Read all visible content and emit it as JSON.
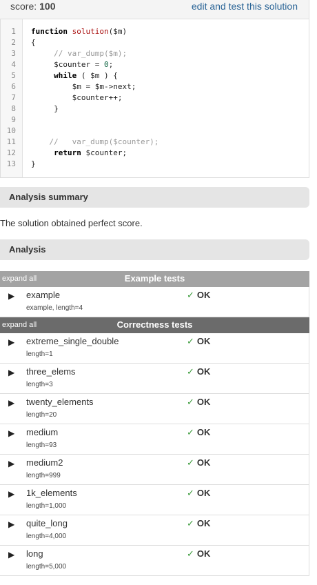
{
  "header": {
    "score_label": "score:",
    "score_value": "100",
    "edit_link": "edit and test this solution"
  },
  "code": {
    "lines": [
      {
        "n": "1",
        "parts": [
          {
            "t": "function",
            "c": "kw"
          },
          {
            "t": " ",
            "c": ""
          },
          {
            "t": "solution",
            "c": "fn"
          },
          {
            "t": "($m)",
            "c": ""
          }
        ]
      },
      {
        "n": "2",
        "parts": [
          {
            "t": "{",
            "c": ""
          }
        ]
      },
      {
        "n": "3",
        "parts": [
          {
            "t": "     // var_dump($m);",
            "c": "cm"
          }
        ]
      },
      {
        "n": "4",
        "parts": [
          {
            "t": "     $counter = ",
            "c": ""
          },
          {
            "t": "0",
            "c": "num"
          },
          {
            "t": ";",
            "c": ""
          }
        ]
      },
      {
        "n": "5",
        "parts": [
          {
            "t": "     ",
            "c": ""
          },
          {
            "t": "while",
            "c": "kw"
          },
          {
            "t": " ( $m ) {",
            "c": ""
          }
        ]
      },
      {
        "n": "6",
        "parts": [
          {
            "t": "         $m = $m->next;",
            "c": ""
          }
        ]
      },
      {
        "n": "7",
        "parts": [
          {
            "t": "         $counter++;",
            "c": ""
          }
        ]
      },
      {
        "n": "8",
        "parts": [
          {
            "t": "     }",
            "c": ""
          }
        ]
      },
      {
        "n": "9",
        "parts": []
      },
      {
        "n": "10",
        "parts": []
      },
      {
        "n": "11",
        "parts": [
          {
            "t": "    //   var_dump($counter);",
            "c": "cm"
          }
        ]
      },
      {
        "n": "12",
        "parts": [
          {
            "t": "     ",
            "c": ""
          },
          {
            "t": "return",
            "c": "kw"
          },
          {
            "t": " $counter;",
            "c": ""
          }
        ]
      },
      {
        "n": "13",
        "parts": [
          {
            "t": "}",
            "c": ""
          }
        ]
      }
    ]
  },
  "analysis_summary": {
    "title": "Analysis summary",
    "text": "The solution obtained perfect score."
  },
  "analysis": {
    "title": "Analysis"
  },
  "example_group": {
    "expand_all": "expand all",
    "title": "Example tests",
    "tests": [
      {
        "name": "example",
        "detail": "example, length=4",
        "status": "OK"
      }
    ]
  },
  "correctness_group": {
    "expand_all": "expand all",
    "title": "Correctness tests",
    "tests": [
      {
        "name": "extreme_single_double",
        "detail": "length=1",
        "status": "OK"
      },
      {
        "name": "three_elems",
        "detail": "length=3",
        "status": "OK"
      },
      {
        "name": "twenty_elements",
        "detail": "length=20",
        "status": "OK"
      },
      {
        "name": "medium",
        "detail": "length=93",
        "status": "OK"
      },
      {
        "name": "medium2",
        "detail": "length=999",
        "status": "OK"
      },
      {
        "name": "1k_elements",
        "detail": "length=1,000",
        "status": "OK"
      },
      {
        "name": "quite_long",
        "detail": "length=4,000",
        "status": "OK"
      },
      {
        "name": "long",
        "detail": "length=5,000",
        "status": "OK"
      }
    ]
  },
  "icons": {
    "caret": "caret-right-icon",
    "check": "check-icon"
  },
  "colors": {
    "link": "#2a6496",
    "check": "#3a9a3a",
    "example_bar": "#a3a3a3",
    "correctness_bar": "#6b6b6b"
  }
}
